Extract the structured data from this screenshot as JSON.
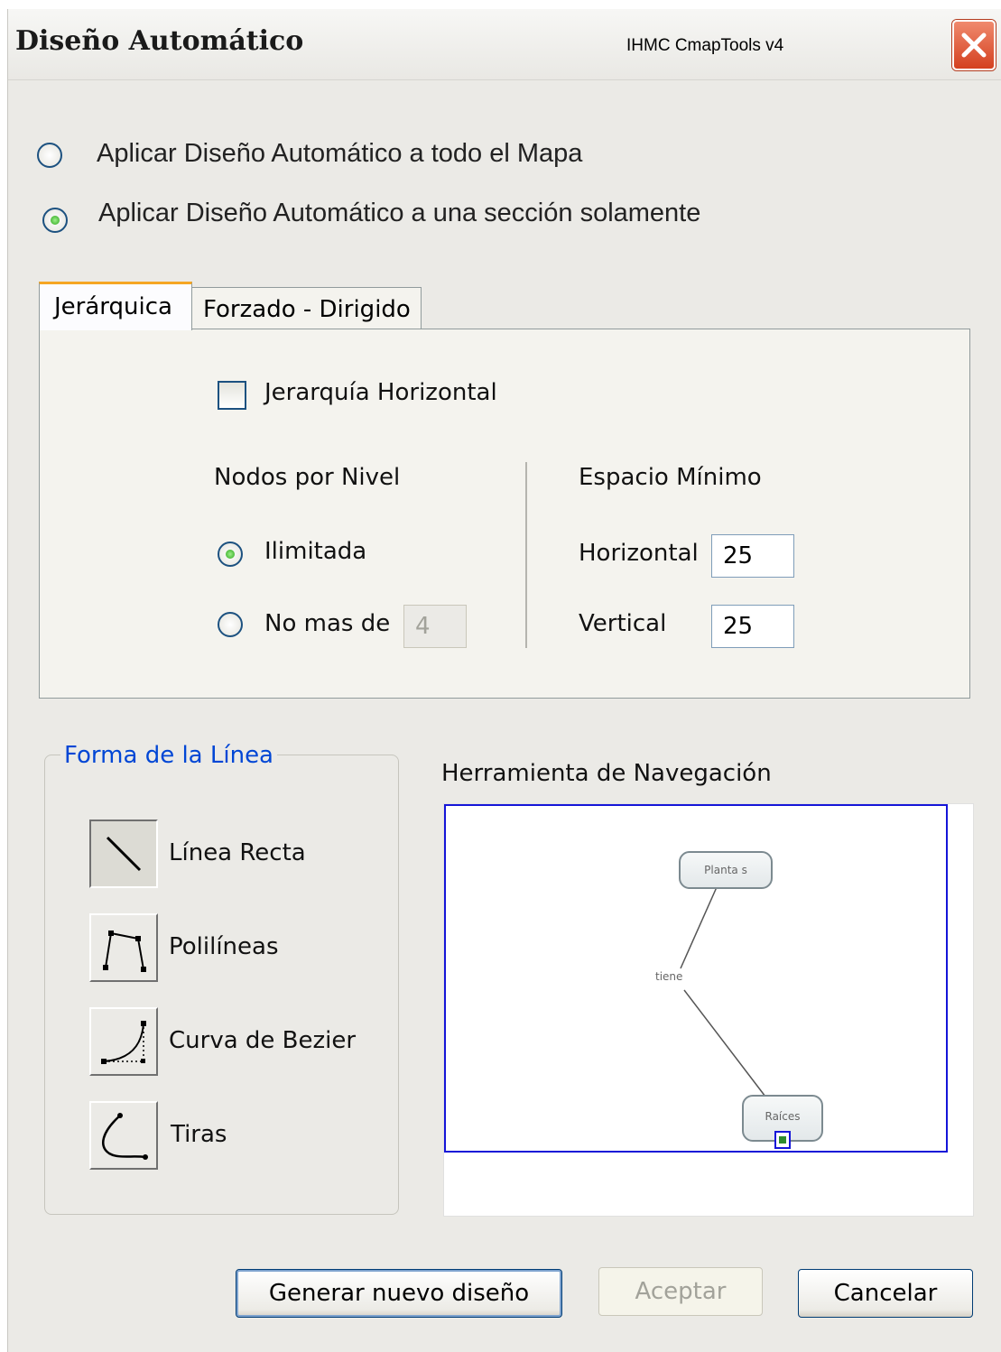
{
  "dialog": {
    "title": "Diseño Automático",
    "app_name": "IHMC CmapTools v4"
  },
  "scope": {
    "options": [
      {
        "label": "Aplicar Diseño Automático a todo el Mapa",
        "selected": false
      },
      {
        "label": "Aplicar Diseño Automático a una sección solamente",
        "selected": true
      }
    ]
  },
  "tabs": [
    {
      "label": "Jerárquica",
      "active": true
    },
    {
      "label": "Forzado  - Dirigido",
      "active": false
    }
  ],
  "hierarchical": {
    "horizontal_checkbox": {
      "label": "Jerarquía Horizontal",
      "checked": false
    },
    "nodes_per_level": {
      "heading": "Nodos por Nivel",
      "unlimited_label": "Ilimitada",
      "unlimited_selected": true,
      "max_label": "No mas de",
      "max_value": "4"
    },
    "min_space": {
      "heading": "Espacio Mínimo",
      "horizontal_label": "Horizontal",
      "horizontal_value": "25",
      "vertical_label": "Vertical",
      "vertical_value": "25"
    }
  },
  "line_shape": {
    "title": "Forma de la Línea",
    "options": [
      {
        "label": "Línea Recta",
        "icon": "straight-line-icon",
        "selected": true
      },
      {
        "label": "Polilíneas",
        "icon": "polyline-icon",
        "selected": false
      },
      {
        "label": "Curva de Bezier",
        "icon": "bezier-curve-icon",
        "selected": false
      },
      {
        "label": "Tiras",
        "icon": "spline-icon",
        "selected": false
      }
    ]
  },
  "navigation": {
    "title": "Herramienta de Navegación",
    "concepts": [
      "Planta s",
      "Raíces"
    ],
    "link_phrase": "tiene"
  },
  "buttons": {
    "generate": "Generar nuevo diseño",
    "accept": "Aceptar",
    "cancel": "Cancelar"
  },
  "colors": {
    "accent_blue": "#0046d5",
    "nav_frame": "#1515d8",
    "active_tab": "#f5a623",
    "close_red": "#d4401f"
  }
}
